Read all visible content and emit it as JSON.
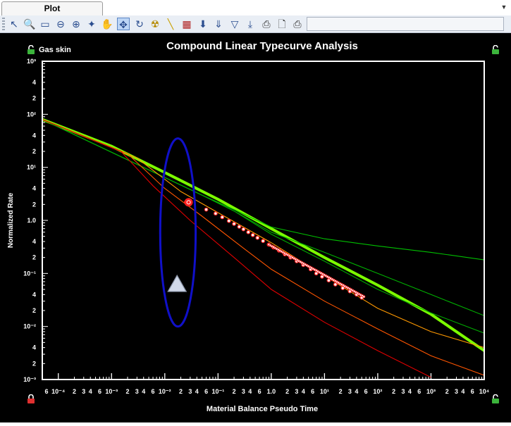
{
  "tabbar": {
    "tab_label": "Plot",
    "menu_icon": "chevron-down-icon"
  },
  "toolbar": {
    "icons": [
      "pointer-icon",
      "zoom-in-icon",
      "zoom-box-icon",
      "zoom-out-icon",
      "zoom-fit-icon",
      "wand-icon",
      "pan-hand-icon",
      "move-icon",
      "rotate-icon",
      "radiation-icon",
      "ruler-icon",
      "grid-icon",
      "arrow-down-icon",
      "arrow-down-double-icon",
      "filter-icon",
      "export-icon",
      "print-icon",
      "print-preview-icon",
      "print-setup-icon"
    ],
    "active_tool": "move-icon"
  },
  "chart_data": {
    "type": "line",
    "title": "Compound Linear Typecurve Analysis",
    "xlabel": "Material Balance Pseudo Time",
    "ylabel": "Normalized Rate",
    "corner_label": "Gas skin",
    "xscale": "log",
    "yscale": "log",
    "xlim": [
      5e-05,
      10000
    ],
    "ylim": [
      0.001,
      1000
    ],
    "x_decade_labels": [
      "10⁻⁴",
      "10⁻³",
      "10⁻²",
      "10⁻¹",
      "1.0",
      "10¹",
      "10²",
      "10³",
      "10⁴"
    ],
    "x_minor_labels": [
      "2",
      "3",
      "4",
      "6"
    ],
    "y_tick_labels": [
      "10⁻³",
      "2",
      "4",
      "10⁻²",
      "2",
      "4",
      "10⁻¹",
      "2",
      "4",
      "1.0",
      "2",
      "4",
      "10¹",
      "2",
      "4",
      "10²",
      "2",
      "4",
      "10³"
    ],
    "colors": {
      "background": "#000000",
      "frame": "#ffffff",
      "highlight_curve": "#7cfc00",
      "data_points": "#ff2020",
      "ellipse": "#1010c8",
      "marker": "#d0d8e8"
    },
    "series": [
      {
        "color": "#7cfc00",
        "x": [
          5e-05,
          0.001,
          0.01,
          0.1,
          1,
          10,
          100,
          1000,
          10000
        ],
        "y": [
          80,
          25,
          8,
          2.5,
          0.7,
          0.2,
          0.06,
          0.017,
          0.0035
        ]
      },
      {
        "color": "#00c000",
        "x": [
          5e-05,
          0.05,
          0.2,
          1,
          10,
          100,
          1000,
          10000
        ],
        "y": [
          80,
          3.0,
          1.6,
          0.75,
          0.45,
          0.33,
          0.25,
          0.18
        ]
      },
      {
        "color": "#00b000",
        "x": [
          5e-05,
          0.05,
          0.2,
          1,
          10,
          100,
          1000,
          10000
        ],
        "y": [
          80,
          3.0,
          1.5,
          0.6,
          0.25,
          0.1,
          0.04,
          0.016
        ]
      },
      {
        "color": "#00a800",
        "x": [
          5e-05,
          0.05,
          0.2,
          1,
          10,
          100,
          1000,
          10000
        ],
        "y": [
          80,
          3.0,
          1.5,
          0.55,
          0.17,
          0.05,
          0.018,
          0.0075
        ]
      },
      {
        "color": "#ff9900",
        "x": [
          5e-05,
          0.003,
          0.02,
          0.1,
          1,
          10,
          100,
          1000,
          10000
        ],
        "y": [
          80,
          15,
          3.5,
          1.4,
          0.38,
          0.09,
          0.022,
          0.008,
          0.004
        ]
      },
      {
        "color": "#ff5500",
        "x": [
          5e-05,
          0.002,
          0.01,
          0.05,
          0.3,
          1,
          10,
          100,
          1000,
          10000
        ],
        "y": [
          80,
          18,
          4,
          1.2,
          0.3,
          0.12,
          0.03,
          0.009,
          0.0028,
          0.0012
        ]
      },
      {
        "color": "#e00000",
        "x": [
          5e-05,
          0.0015,
          0.006,
          0.03,
          0.2,
          1,
          10,
          100,
          1000
        ],
        "y": [
          80,
          20,
          4.5,
          1.0,
          0.2,
          0.05,
          0.012,
          0.0035,
          0.0011
        ]
      }
    ],
    "data_points": [
      [
        0.025,
        2.2
      ],
      [
        0.06,
        1.6
      ],
      [
        0.09,
        1.35
      ],
      [
        0.12,
        1.15
      ],
      [
        0.16,
        0.98
      ],
      [
        0.2,
        0.86
      ],
      [
        0.25,
        0.76
      ],
      [
        0.3,
        0.68
      ],
      [
        0.37,
        0.6
      ],
      [
        0.45,
        0.53
      ],
      [
        0.55,
        0.47
      ],
      [
        0.7,
        0.41
      ],
      [
        0.9,
        0.35
      ],
      [
        1.1,
        0.31
      ],
      [
        1.4,
        0.27
      ],
      [
        1.8,
        0.23
      ],
      [
        2.3,
        0.2
      ],
      [
        3,
        0.17
      ],
      [
        4,
        0.145
      ],
      [
        5.5,
        0.12
      ],
      [
        7,
        0.1
      ],
      [
        9,
        0.087
      ],
      [
        12,
        0.074
      ],
      [
        16,
        0.062
      ],
      [
        22,
        0.053
      ],
      [
        30,
        0.046
      ],
      [
        40,
        0.04
      ],
      [
        50,
        0.035
      ]
    ],
    "selected_point": [
      0.028,
      2.2
    ],
    "marker_point": [
      0.017,
      0.06
    ],
    "annotation_ellipse": {
      "x_min": 0.0082,
      "x_max": 0.038,
      "y_min": 0.01,
      "y_max": 35
    }
  }
}
